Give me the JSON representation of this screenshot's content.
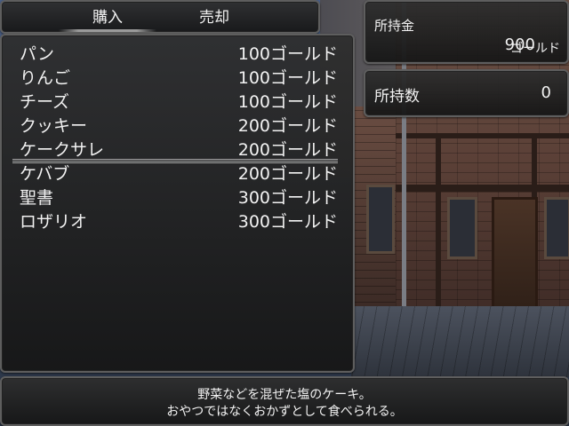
{
  "tabs": {
    "buy": "購入",
    "sell": "売却"
  },
  "items": [
    {
      "name": "パン",
      "price": "100ゴールド"
    },
    {
      "name": "りんご",
      "price": "100ゴールド"
    },
    {
      "name": "チーズ",
      "price": "100ゴールド"
    },
    {
      "name": "クッキー",
      "price": "200ゴールド"
    },
    {
      "name": "ケークサレ",
      "price": "200ゴールド"
    },
    {
      "name": "ケバブ",
      "price": "200ゴールド"
    },
    {
      "name": "聖書",
      "price": "300ゴールド"
    },
    {
      "name": "ロザリオ",
      "price": "300ゴールド"
    }
  ],
  "selected_index": 4,
  "gold": {
    "label": "所持金",
    "amount": "900",
    "unit": "ゴールド"
  },
  "owned": {
    "label": "所持数",
    "count": "0"
  },
  "description": {
    "line1": "野菜などを混ぜた塩のケーキ。",
    "line2": "おやつではなくおかずとして食べられる。"
  }
}
